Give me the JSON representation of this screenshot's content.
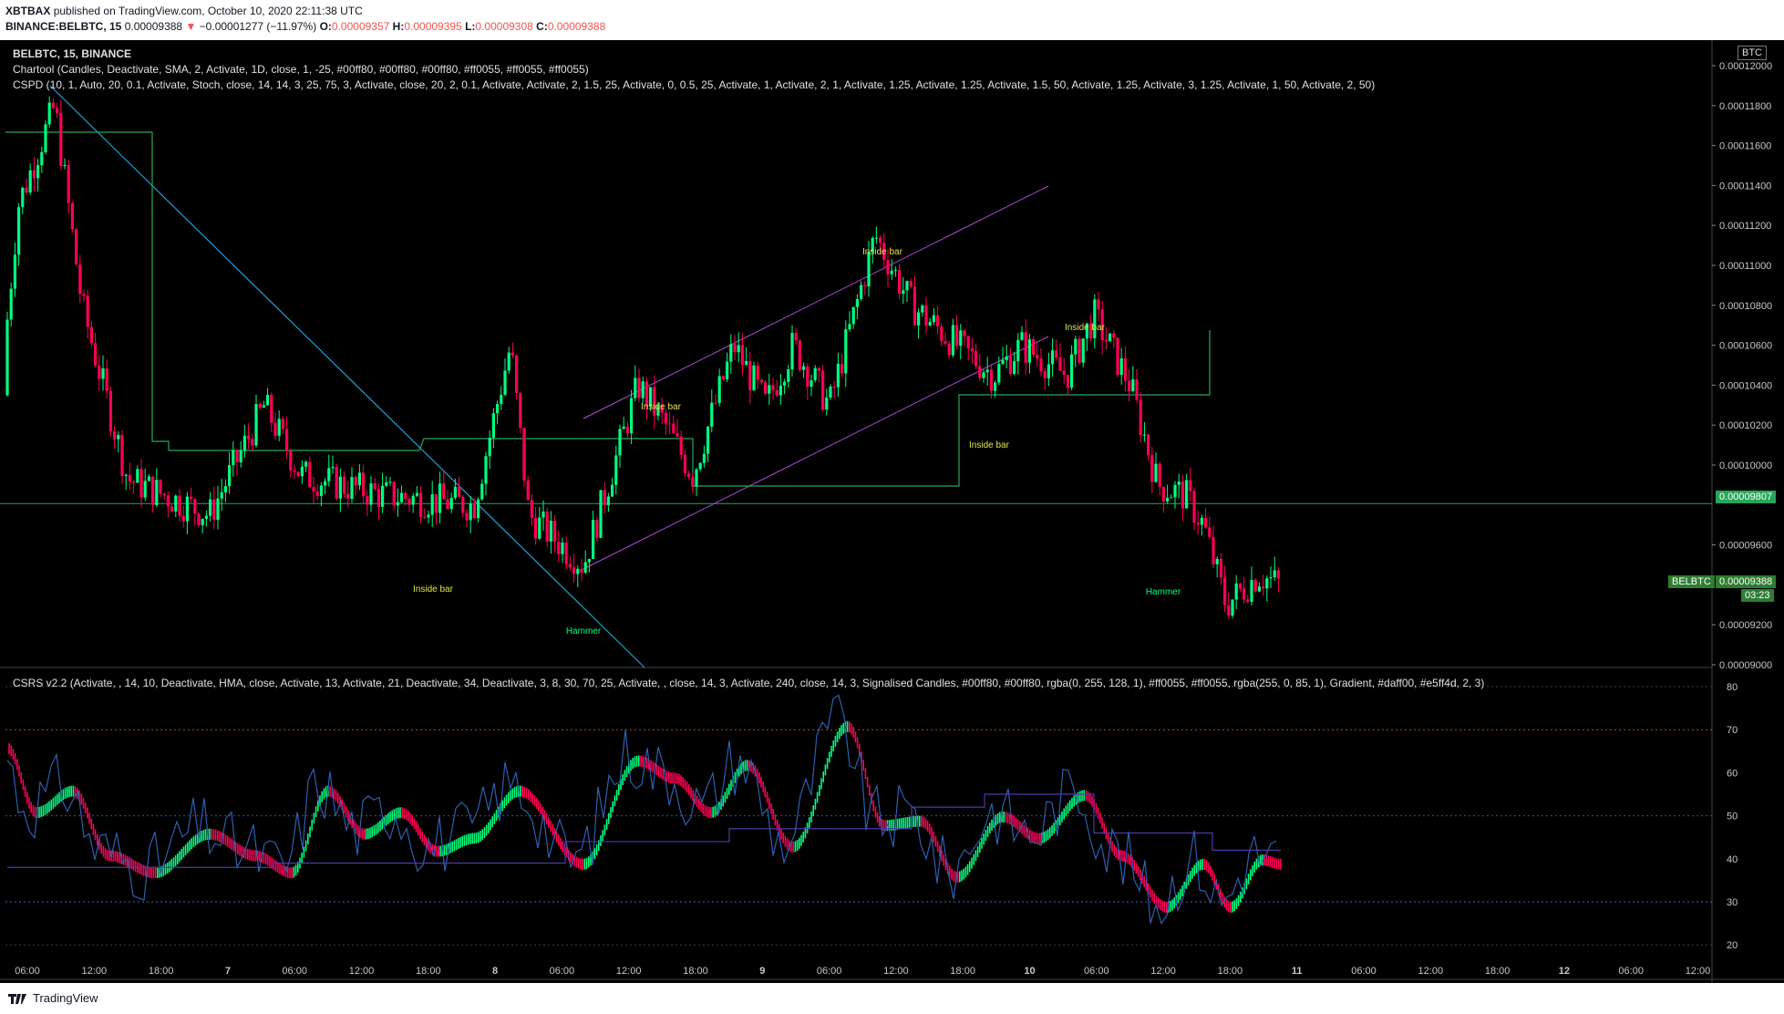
{
  "header": {
    "author": "XBTBAX",
    "published_text": "published on TradingView.com, October 10, 2020 22:11:38 UTC",
    "symbol_line": "BINANCE:BELBTC, 15",
    "last": "0.00009388",
    "change_arrow": "▼",
    "change": "−0.00001277 (−11.97%)",
    "o_label": "O:",
    "o": "0.00009357",
    "h_label": "H:",
    "h": "0.00009395",
    "l_label": "L:",
    "l": "0.00009308",
    "c_label": "C:",
    "c": "0.00009388"
  },
  "legend": {
    "symbol": "BELBTC, 15, BINANCE",
    "chartool": "Chartool (Candles, Deactivate, SMA, 2, Activate, 1D, close, 1, -25, #00ff80, #00ff80, #00ff80, #ff0055, #ff0055, #ff0055)",
    "cspd": "CSPD (10, 1, Auto, 20, 0.1, Activate, Stoch, close, 14, 14, 3, 25, 75, 3, Activate, close, 20, 2, 0.1, Activate, Activate, 2, 1.5, 25, Activate, 0, 0.5, 25, Activate, 1, Activate, 2, 1, Activate, 1.25, Activate, 1.25, Activate, 1.5, 50, Activate, 1.25, Activate, 3, 1.25, Activate, 1, 50, Activate, 2, 50)",
    "csrs": "CSRS v2.2 (Activate, , 14, 10, Deactivate, HMA, close, Activate, 13, Activate, 21, Deactivate, 34, Deactivate, 3, 8, 30, 70, 25, Activate, , close, 14, 3, Activate, 240, close, 14, 3, Signalised Candles, #00ff80, #00ff80, rgba(0, 255, 128, 1), #ff0055, #ff0055, rgba(255, 0, 85, 1), Gradient, #daff00, #e5ff4d, 2, 3)"
  },
  "price_axis": {
    "currency": "BTC",
    "labels": [
      "0.00012000",
      "0.00011800",
      "0.00011600",
      "0.00011400",
      "0.00011200",
      "0.00011000",
      "0.00010800",
      "0.00010600",
      "0.00010400",
      "0.00010200",
      "0.00010000",
      "0.00009600",
      "0.00009200",
      "0.00009000"
    ],
    "hline_label": "0.00009807",
    "price_tag_symbol": "BELBTC",
    "price_tag_value": "0.00009388",
    "countdown": "03:23"
  },
  "osc_axis": {
    "labels": [
      "80",
      "70",
      "60",
      "50",
      "40",
      "30",
      "20"
    ]
  },
  "time_axis": {
    "labels": [
      "06:00",
      "12:00",
      "18:00",
      "7",
      "06:00",
      "12:00",
      "18:00",
      "8",
      "06:00",
      "12:00",
      "18:00",
      "9",
      "06:00",
      "12:00",
      "18:00",
      "10",
      "06:00",
      "12:00",
      "18:00",
      "11",
      "06:00",
      "12:00",
      "18:00",
      "12",
      "06:00",
      "12:00"
    ]
  },
  "patterns": [
    {
      "text": "Inside bar",
      "color": "#e5e54d"
    },
    {
      "text": "Inside bar",
      "color": "#e5e54d"
    },
    {
      "text": "Inside bar",
      "color": "#e5e54d"
    },
    {
      "text": "Inside bar",
      "color": "#e5e54d"
    },
    {
      "text": "Inside bar",
      "color": "#e5e54d"
    },
    {
      "text": "Hammer",
      "color": "#00ff80"
    },
    {
      "text": "Hammer",
      "color": "#00ff80"
    }
  ],
  "colors": {
    "bull": "#00ff80",
    "bear": "#ff0055",
    "channel": "#b44be0",
    "trendline": "#1e9fd6",
    "sr_line": "#26a65b",
    "background": "#000000"
  },
  "footer": {
    "brand": "TradingView"
  }
}
